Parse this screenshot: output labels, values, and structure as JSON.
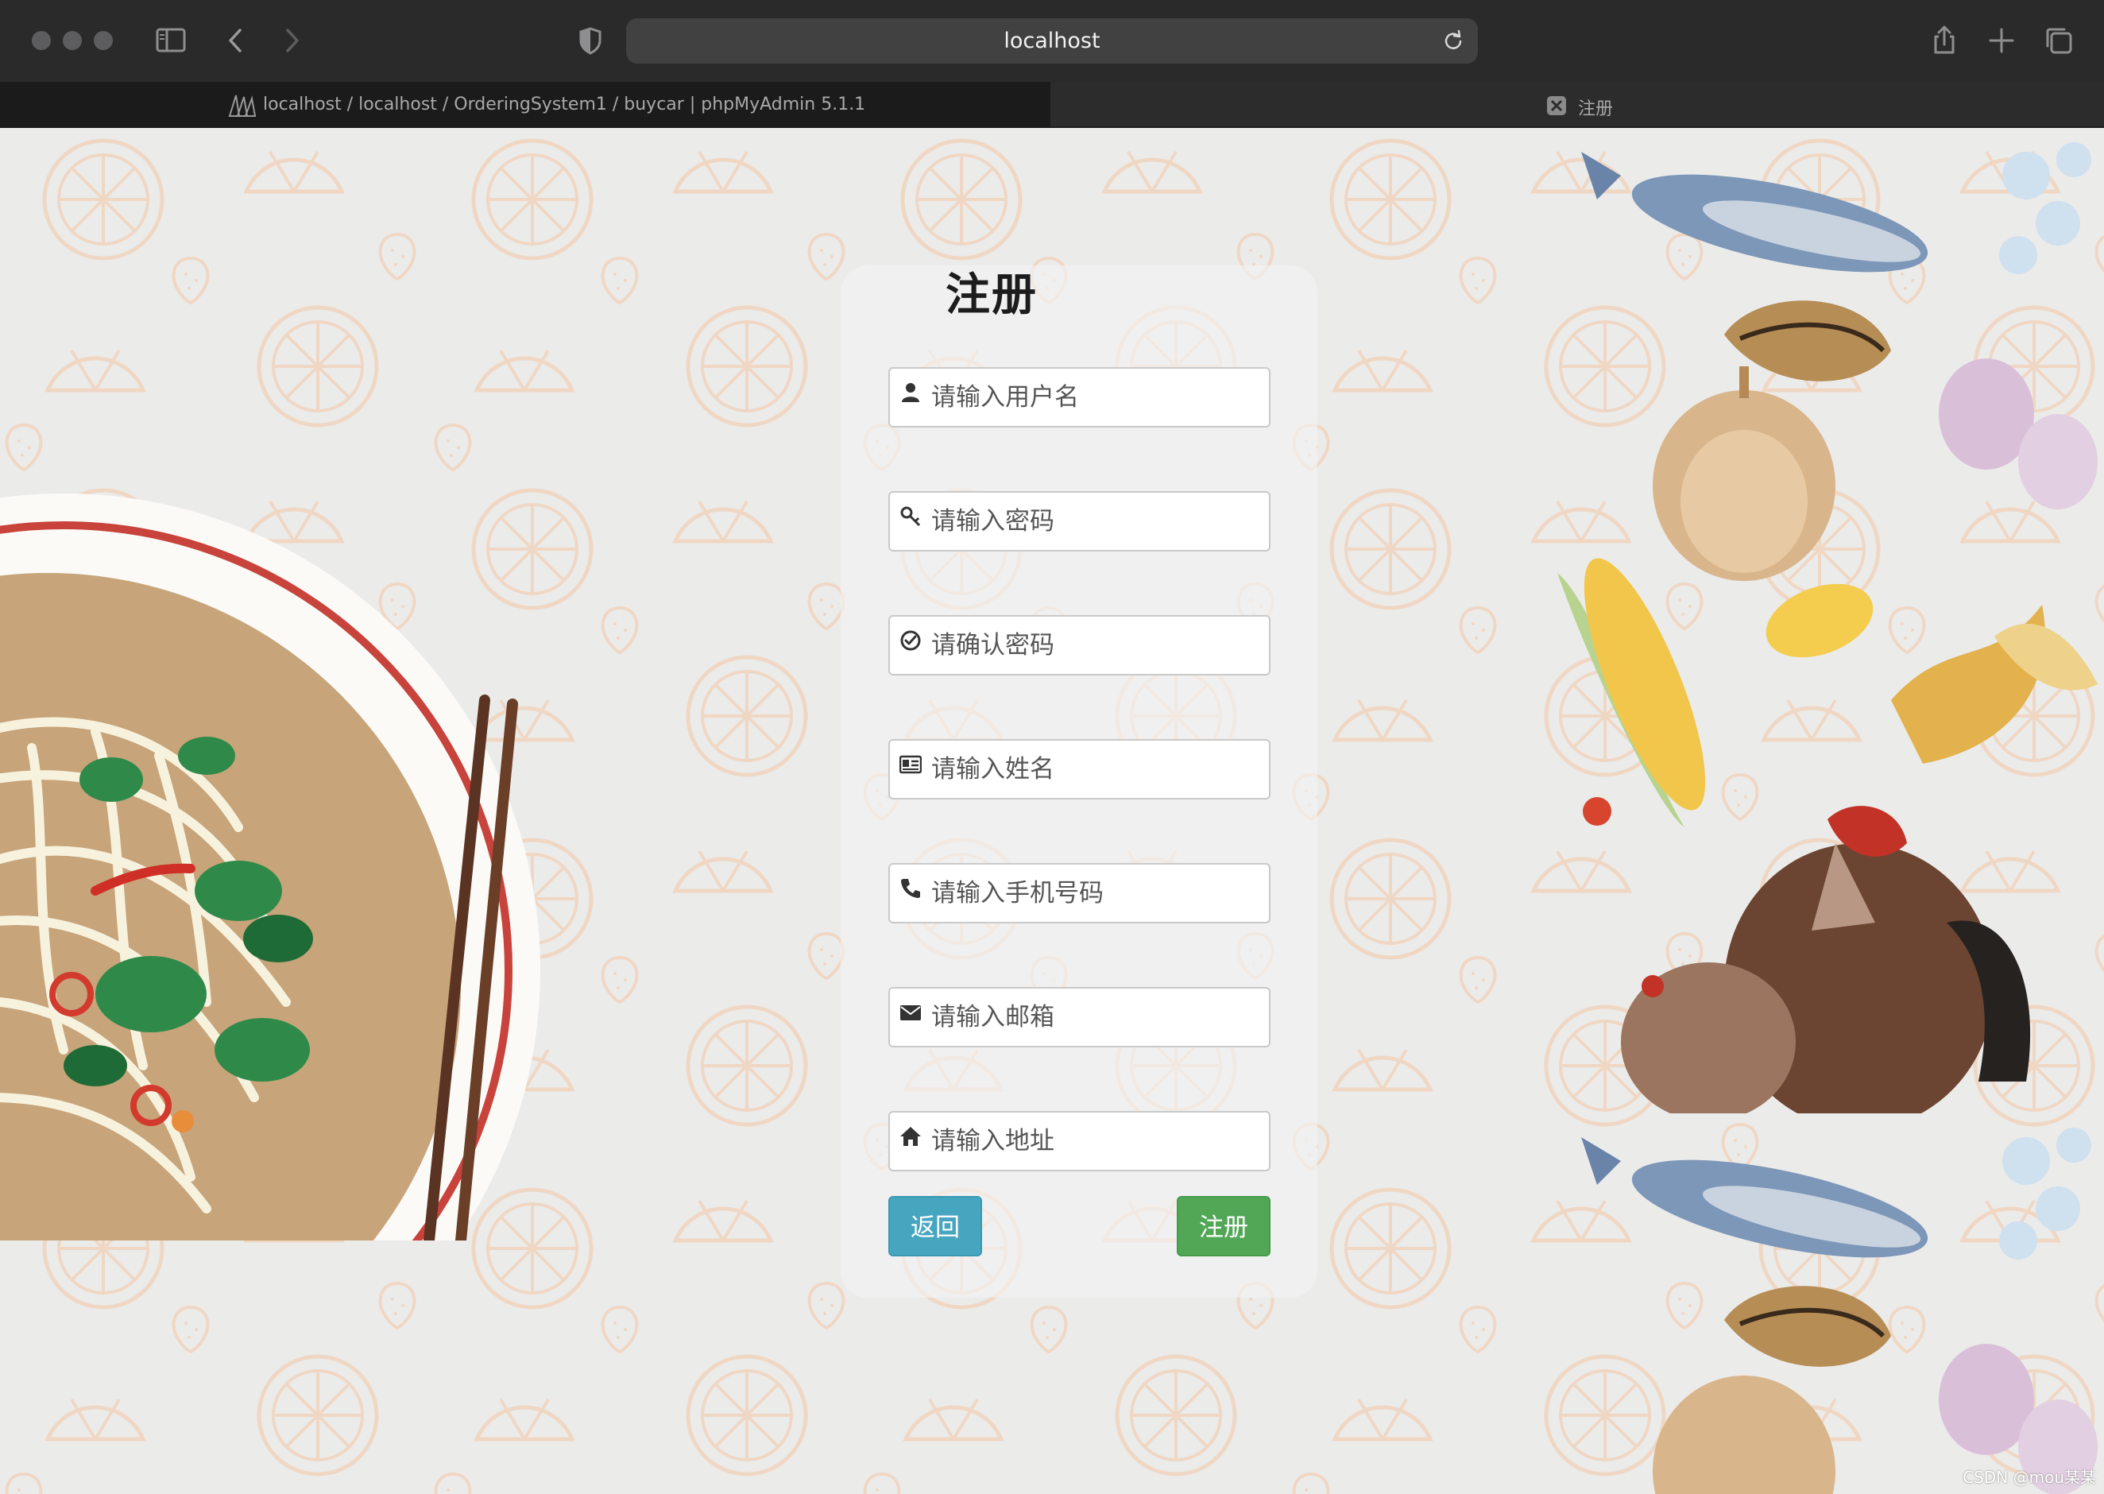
{
  "browser": {
    "url": "localhost",
    "tabs": [
      {
        "label": "localhost / localhost / OrderingSystem1 / buycar | phpMyAdmin 5.1.1",
        "active": false
      },
      {
        "label": "注册",
        "active": true
      }
    ],
    "icons": [
      "sidebar-icon",
      "back-icon",
      "forward-icon",
      "shield-icon",
      "reload-icon",
      "share-icon",
      "new-tab-icon",
      "tabs-overview-icon"
    ]
  },
  "form": {
    "title": "注册",
    "fields": [
      {
        "icon": "user-icon",
        "placeholder": "请输入用户名",
        "value": ""
      },
      {
        "icon": "key-icon",
        "placeholder": "请输入密码",
        "value": ""
      },
      {
        "icon": "check-circle-icon",
        "placeholder": "请确认密码",
        "value": ""
      },
      {
        "icon": "id-card-icon",
        "placeholder": "请输入姓名",
        "value": ""
      },
      {
        "icon": "phone-icon",
        "placeholder": "请输入手机号码",
        "value": ""
      },
      {
        "icon": "envelope-icon",
        "placeholder": "请输入邮箱",
        "value": ""
      },
      {
        "icon": "home-icon",
        "placeholder": "请输入地址",
        "value": ""
      }
    ],
    "back_label": "返回",
    "submit_label": "注册"
  },
  "colors": {
    "back_button": "#46a6c0",
    "submit_button": "#52a756",
    "page_background": "#ebebea"
  },
  "watermark": "CSDN @mou某某"
}
